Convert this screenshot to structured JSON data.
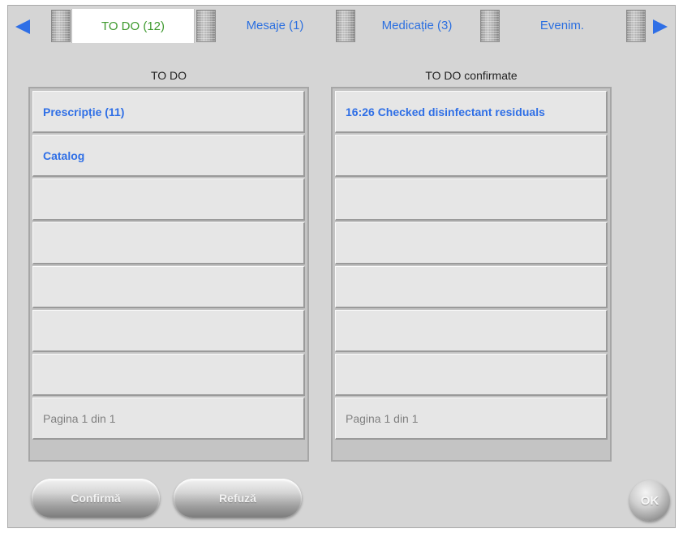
{
  "tabs": [
    {
      "label": "TO DO (12)",
      "active": true
    },
    {
      "label": "Mesaje (1)",
      "active": false
    },
    {
      "label": "Medicație (3)",
      "active": false
    },
    {
      "label": "Evenim.",
      "active": false
    }
  ],
  "icons": {
    "prev": "left-arrow-icon",
    "next": "right-arrow-icon"
  },
  "colors": {
    "tab_label": "#2b6fe0",
    "active_tab_label": "#3f9a2f",
    "row_text": "#2f6fe6",
    "pager_text": "#808080"
  },
  "todo": {
    "title": "TO DO",
    "items": [
      "Prescripție (11)",
      "Catalog",
      "",
      "",
      "",
      "",
      ""
    ],
    "pager": "Pagina 1 din 1"
  },
  "confirmed": {
    "title": "TO DO confirmate",
    "items": [
      "16:26 Checked disinfectant residuals",
      "",
      "",
      "",
      "",
      "",
      ""
    ],
    "pager": "Pagina 1 din 1"
  },
  "buttons": {
    "confirm": "Confirmă",
    "refuse": "Refuză",
    "ok": "OK"
  }
}
